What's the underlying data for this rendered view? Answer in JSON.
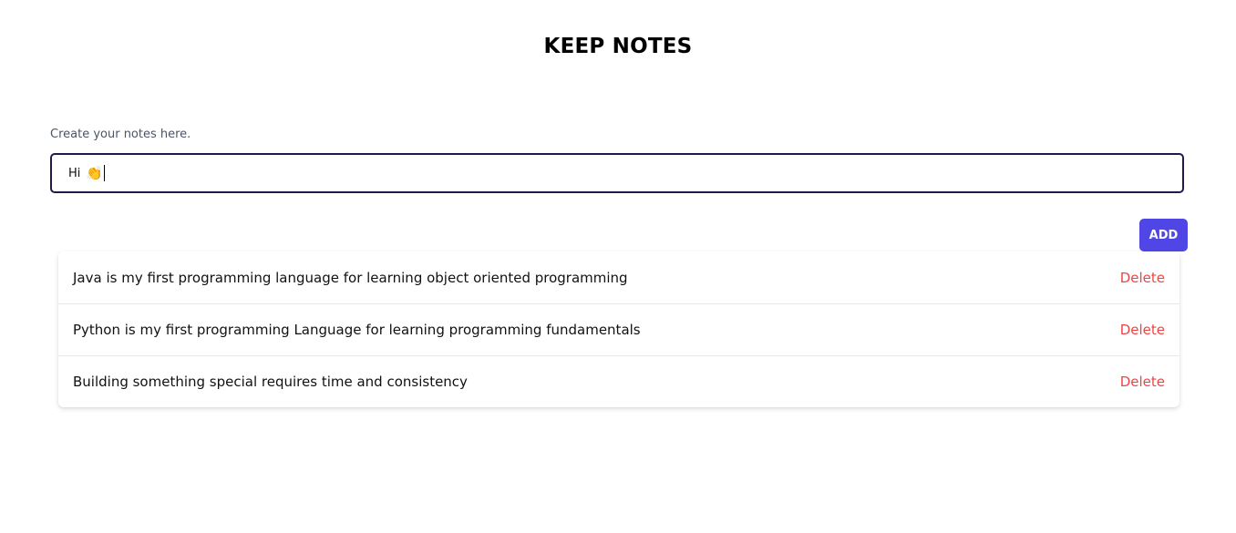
{
  "header": {
    "title": "KEEP NOTES"
  },
  "form": {
    "label": "Create your notes here.",
    "input_value": "Hi",
    "input_emoji": "👏",
    "add_label": "ADD"
  },
  "notes": [
    {
      "text": "Java is my first programming language for learning object oriented programming",
      "delete_label": "Delete"
    },
    {
      "text": "Python is my first programming Language for learning programming fundamentals",
      "delete_label": "Delete"
    },
    {
      "text": "Building something special requires time and consistency",
      "delete_label": "Delete"
    }
  ],
  "colors": {
    "accent": "#4f46e5",
    "delete": "#ef4444",
    "input_border": "#1e1b4b"
  }
}
